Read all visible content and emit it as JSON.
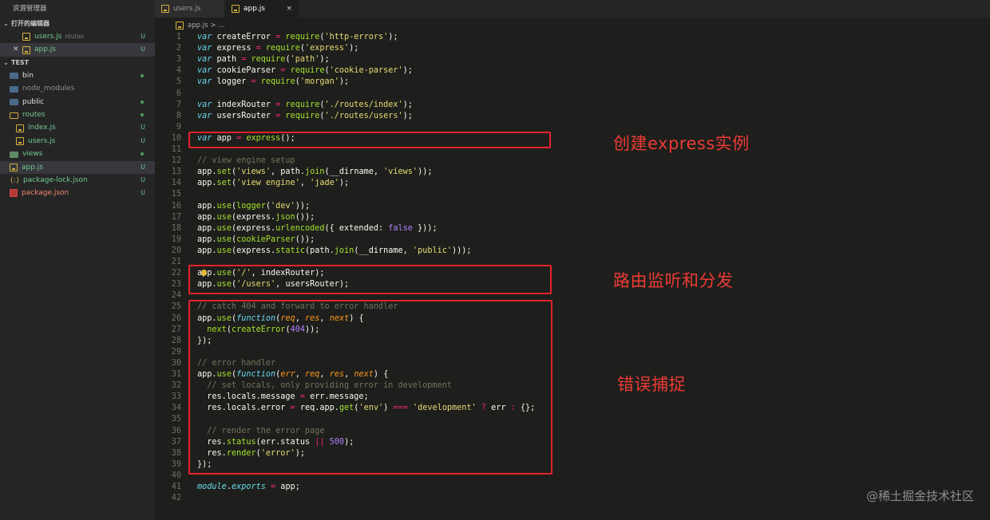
{
  "sidebar": {
    "title": "资源管理器",
    "open_editors": {
      "label": "打开的编辑器",
      "items": [
        {
          "name": "users.js",
          "hint": "routes",
          "status": "U"
        },
        {
          "name": "app.js",
          "hint": "",
          "status": "U"
        }
      ]
    },
    "project": {
      "label": "TEST",
      "items": [
        {
          "name": "bin",
          "status": ""
        },
        {
          "name": "node_modules",
          "status": ""
        },
        {
          "name": "public",
          "status": ""
        },
        {
          "name": "routes",
          "status": ""
        },
        {
          "name": "index.js",
          "status": "U"
        },
        {
          "name": "users.js",
          "status": "U"
        },
        {
          "name": "views",
          "status": ""
        },
        {
          "name": "app.js",
          "status": "U"
        },
        {
          "name": "package-lock.json",
          "status": "U"
        },
        {
          "name": "package.json",
          "status": "U"
        }
      ]
    }
  },
  "tabs": [
    {
      "label": "users.js"
    },
    {
      "label": "app.js",
      "close": "×"
    }
  ],
  "breadcrumb": {
    "file": "app.js",
    "sep": ">",
    "more": "..."
  },
  "annotations": {
    "create_app": "创建express实例",
    "routing": "路由监听和分发",
    "errors": "错误捕捉"
  },
  "watermark": "@稀土掘金技术社区",
  "colors": {
    "background": "#1e1f1c",
    "sidebar": "#252526",
    "annotation": "#e4232b",
    "keyword": "#66d9ef",
    "function": "#a6e22e",
    "string": "#e6db74",
    "comment": "#75715e",
    "operator": "#f92672"
  },
  "code_lines": [
    [
      [
        "kw",
        "var"
      ],
      [
        "pl",
        " createError "
      ],
      [
        "op",
        "="
      ],
      [
        "pl",
        " "
      ],
      [
        "fn",
        "require"
      ],
      [
        "pl",
        "("
      ],
      [
        "str",
        "'http-errors'"
      ],
      [
        "pl",
        ");"
      ]
    ],
    [
      [
        "kw",
        "var"
      ],
      [
        "pl",
        " express "
      ],
      [
        "op",
        "="
      ],
      [
        "pl",
        " "
      ],
      [
        "fn",
        "require"
      ],
      [
        "pl",
        "("
      ],
      [
        "str",
        "'express'"
      ],
      [
        "pl",
        ");"
      ]
    ],
    [
      [
        "kw",
        "var"
      ],
      [
        "pl",
        " path "
      ],
      [
        "op",
        "="
      ],
      [
        "pl",
        " "
      ],
      [
        "fn",
        "require"
      ],
      [
        "pl",
        "("
      ],
      [
        "str",
        "'path'"
      ],
      [
        "pl",
        ");"
      ]
    ],
    [
      [
        "kw",
        "var"
      ],
      [
        "pl",
        " cookieParser "
      ],
      [
        "op",
        "="
      ],
      [
        "pl",
        " "
      ],
      [
        "fn",
        "require"
      ],
      [
        "pl",
        "("
      ],
      [
        "str",
        "'cookie-parser'"
      ],
      [
        "pl",
        ");"
      ]
    ],
    [
      [
        "kw",
        "var"
      ],
      [
        "pl",
        " logger "
      ],
      [
        "op",
        "="
      ],
      [
        "pl",
        " "
      ],
      [
        "fn",
        "require"
      ],
      [
        "pl",
        "("
      ],
      [
        "str",
        "'morgan'"
      ],
      [
        "pl",
        ");"
      ]
    ],
    [],
    [
      [
        "kw",
        "var"
      ],
      [
        "pl",
        " indexRouter "
      ],
      [
        "op",
        "="
      ],
      [
        "pl",
        " "
      ],
      [
        "fn",
        "require"
      ],
      [
        "pl",
        "("
      ],
      [
        "str",
        "'./routes/index'"
      ],
      [
        "pl",
        ");"
      ]
    ],
    [
      [
        "kw",
        "var"
      ],
      [
        "pl",
        " usersRouter "
      ],
      [
        "op",
        "="
      ],
      [
        "pl",
        " "
      ],
      [
        "fn",
        "require"
      ],
      [
        "pl",
        "("
      ],
      [
        "str",
        "'./routes/users'"
      ],
      [
        "pl",
        ");"
      ]
    ],
    [],
    [
      [
        "kw",
        "var"
      ],
      [
        "pl",
        " app "
      ],
      [
        "op",
        "="
      ],
      [
        "pl",
        " "
      ],
      [
        "fn",
        "express"
      ],
      [
        "pl",
        "();"
      ]
    ],
    [],
    [
      [
        "cm",
        "// view engine setup"
      ]
    ],
    [
      [
        "pl",
        "app."
      ],
      [
        "fn",
        "set"
      ],
      [
        "pl",
        "("
      ],
      [
        "str",
        "'views'"
      ],
      [
        "pl",
        ", path."
      ],
      [
        "fn",
        "join"
      ],
      [
        "pl",
        "(__dirname, "
      ],
      [
        "str",
        "'views'"
      ],
      [
        "pl",
        "));"
      ]
    ],
    [
      [
        "pl",
        "app."
      ],
      [
        "fn",
        "set"
      ],
      [
        "pl",
        "("
      ],
      [
        "str",
        "'view engine'"
      ],
      [
        "pl",
        ", "
      ],
      [
        "str",
        "'jade'"
      ],
      [
        "pl",
        ");"
      ]
    ],
    [],
    [
      [
        "pl",
        "app."
      ],
      [
        "fn",
        "use"
      ],
      [
        "pl",
        "("
      ],
      [
        "fn",
        "logger"
      ],
      [
        "pl",
        "("
      ],
      [
        "str",
        "'dev'"
      ],
      [
        "pl",
        "));"
      ]
    ],
    [
      [
        "pl",
        "app."
      ],
      [
        "fn",
        "use"
      ],
      [
        "pl",
        "(express."
      ],
      [
        "fn",
        "json"
      ],
      [
        "pl",
        "());"
      ]
    ],
    [
      [
        "pl",
        "app."
      ],
      [
        "fn",
        "use"
      ],
      [
        "pl",
        "(express."
      ],
      [
        "fn",
        "urlencoded"
      ],
      [
        "pl",
        "({ extended: "
      ],
      [
        "num",
        "false"
      ],
      [
        "pl",
        " }));"
      ]
    ],
    [
      [
        "pl",
        "app."
      ],
      [
        "fn",
        "use"
      ],
      [
        "pl",
        "("
      ],
      [
        "fn",
        "cookieParser"
      ],
      [
        "pl",
        "());"
      ]
    ],
    [
      [
        "pl",
        "app."
      ],
      [
        "fn",
        "use"
      ],
      [
        "pl",
        "(express."
      ],
      [
        "fn",
        "static"
      ],
      [
        "pl",
        "(path."
      ],
      [
        "fn",
        "join"
      ],
      [
        "pl",
        "(__dirname, "
      ],
      [
        "str",
        "'public'"
      ],
      [
        "pl",
        ")));"
      ]
    ],
    [],
    [
      [
        "pl",
        "app."
      ],
      [
        "fn",
        "use"
      ],
      [
        "pl",
        "("
      ],
      [
        "str",
        "'/'"
      ],
      [
        "pl",
        ", indexRouter);"
      ]
    ],
    [
      [
        "pl",
        "app."
      ],
      [
        "fn",
        "use"
      ],
      [
        "pl",
        "("
      ],
      [
        "str",
        "'/users'"
      ],
      [
        "pl",
        ", usersRouter);"
      ]
    ],
    [],
    [
      [
        "cm",
        "// catch 404 and forward to error handler"
      ]
    ],
    [
      [
        "pl",
        "app."
      ],
      [
        "fn",
        "use"
      ],
      [
        "pl",
        "("
      ],
      [
        "kw",
        "function"
      ],
      [
        "pl",
        "("
      ],
      [
        "prm",
        "req"
      ],
      [
        "pl",
        ", "
      ],
      [
        "prm",
        "res"
      ],
      [
        "pl",
        ", "
      ],
      [
        "prm",
        "next"
      ],
      [
        "pl",
        ") {"
      ]
    ],
    [
      [
        "pl",
        "  "
      ],
      [
        "fn",
        "next"
      ],
      [
        "pl",
        "("
      ],
      [
        "fn",
        "createError"
      ],
      [
        "pl",
        "("
      ],
      [
        "num",
        "404"
      ],
      [
        "pl",
        "));"
      ]
    ],
    [
      [
        "pl",
        "});"
      ]
    ],
    [],
    [
      [
        "cm",
        "// error handler"
      ]
    ],
    [
      [
        "pl",
        "app."
      ],
      [
        "fn",
        "use"
      ],
      [
        "pl",
        "("
      ],
      [
        "kw",
        "function"
      ],
      [
        "pl",
        "("
      ],
      [
        "prm",
        "err"
      ],
      [
        "pl",
        ", "
      ],
      [
        "prm",
        "req"
      ],
      [
        "pl",
        ", "
      ],
      [
        "prm",
        "res"
      ],
      [
        "pl",
        ", "
      ],
      [
        "prm",
        "next"
      ],
      [
        "pl",
        ") {"
      ]
    ],
    [
      [
        "cm",
        "  // set locals, only providing error in development"
      ]
    ],
    [
      [
        "pl",
        "  res.locals.message "
      ],
      [
        "op",
        "="
      ],
      [
        "pl",
        " err.message;"
      ]
    ],
    [
      [
        "pl",
        "  res.locals.error "
      ],
      [
        "op",
        "="
      ],
      [
        "pl",
        " req.app."
      ],
      [
        "fn",
        "get"
      ],
      [
        "pl",
        "("
      ],
      [
        "str",
        "'env'"
      ],
      [
        "pl",
        ") "
      ],
      [
        "op",
        "==="
      ],
      [
        "pl",
        " "
      ],
      [
        "str",
        "'development'"
      ],
      [
        "pl",
        " "
      ],
      [
        "op",
        "?"
      ],
      [
        "pl",
        " err "
      ],
      [
        "op",
        ":"
      ],
      [
        "pl",
        " {};"
      ]
    ],
    [],
    [
      [
        "cm",
        "  // render the error page"
      ]
    ],
    [
      [
        "pl",
        "  res."
      ],
      [
        "fn",
        "status"
      ],
      [
        "pl",
        "(err.status "
      ],
      [
        "op",
        "||"
      ],
      [
        "pl",
        " "
      ],
      [
        "num",
        "500"
      ],
      [
        "pl",
        ");"
      ]
    ],
    [
      [
        "pl",
        "  res."
      ],
      [
        "fn",
        "render"
      ],
      [
        "pl",
        "("
      ],
      [
        "str",
        "'error'"
      ],
      [
        "pl",
        ");"
      ]
    ],
    [
      [
        "pl",
        "});"
      ]
    ],
    [],
    [
      [
        "kw",
        "module"
      ],
      [
        "pl",
        "."
      ],
      [
        "kw",
        "exports"
      ],
      [
        "pl",
        " "
      ],
      [
        "op",
        "="
      ],
      [
        "pl",
        " app;"
      ]
    ],
    []
  ]
}
